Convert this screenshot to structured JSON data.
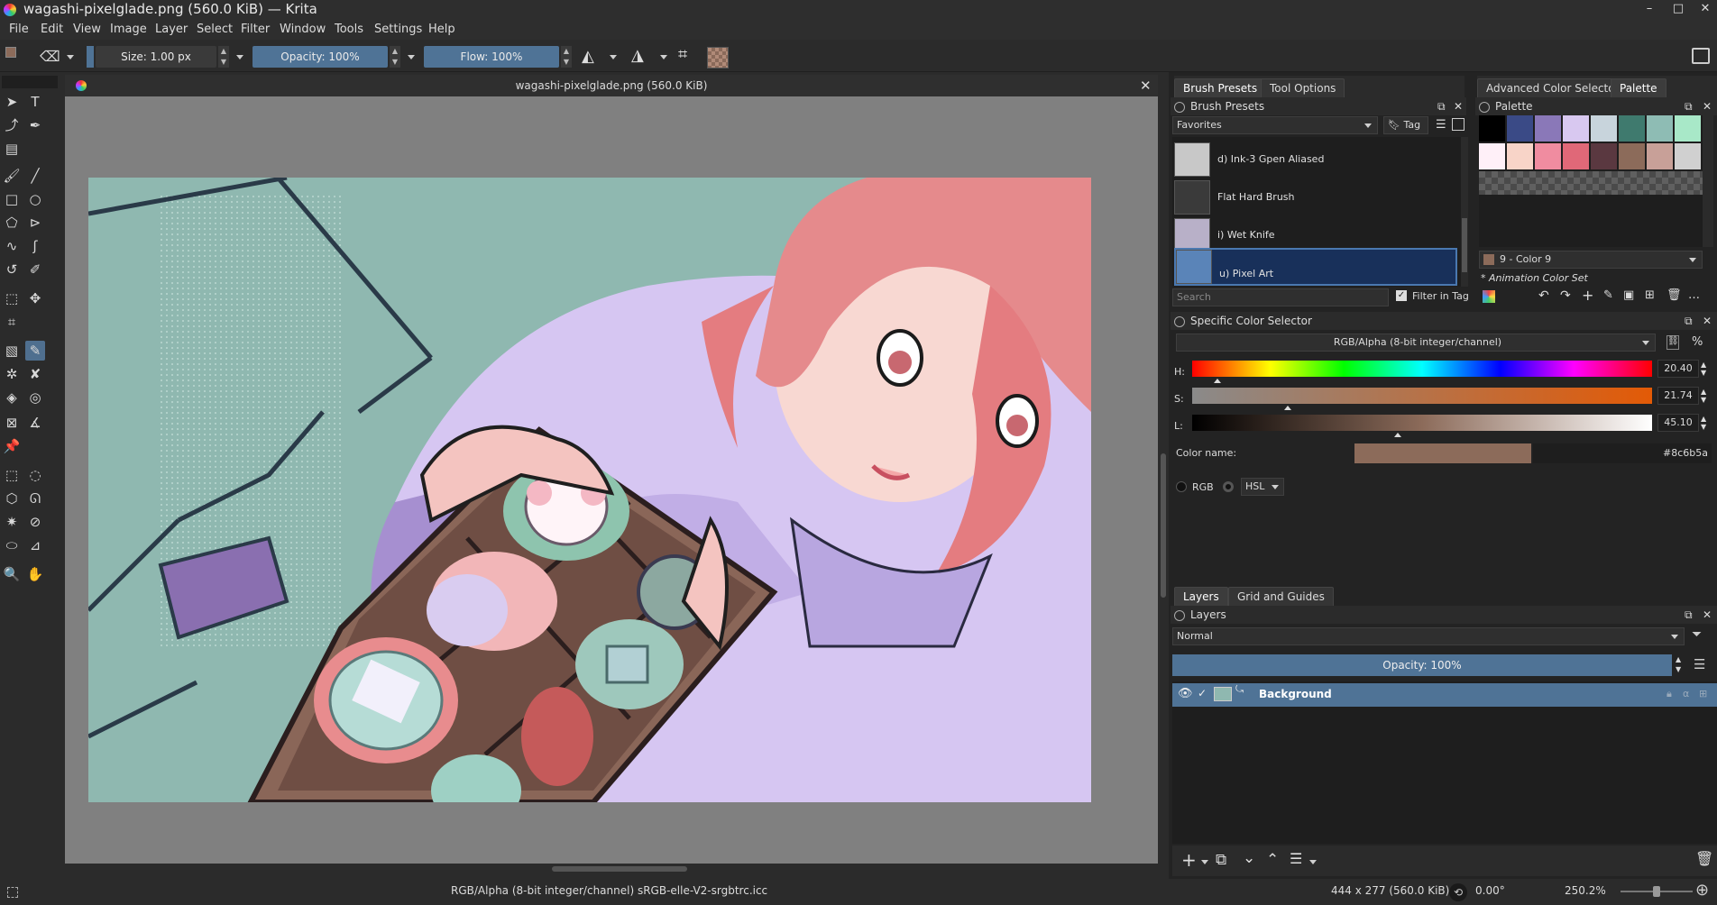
{
  "window": {
    "title": "wagashi-pixelglade.png (560.0 KiB)  — Krita"
  },
  "menu": [
    "File",
    "Edit",
    "View",
    "Image",
    "Layer",
    "Select",
    "Filter",
    "Window",
    "Tools",
    "Settings",
    "Help"
  ],
  "toolbar": {
    "size": "Size: 1.00 px",
    "opacity": "Opacity: 100%",
    "flow": "Flow: 100%"
  },
  "document": {
    "tab_title": "wagashi-pixelglade.png (560.0 KiB)"
  },
  "status": {
    "colorspace": "RGB/Alpha (8-bit integer/channel)  sRGB-elle-V2-srgbtrc.icc",
    "dimensions": "444 x 277 (560.0 KiB)",
    "rotation": "0.00°",
    "zoom": "250.2%"
  },
  "brush_panel": {
    "tabs": [
      "Brush Presets",
      "Tool Options"
    ],
    "title": "Brush Presets",
    "tag_combo": "Favorites",
    "tag_label": "Tag",
    "presets": [
      "d) Ink-3 Gpen Aliased",
      "Flat Hard Brush",
      "i) Wet Knife",
      "u) Pixel Art"
    ],
    "search_placeholder": "Search",
    "filter_label": "Filter in Tag"
  },
  "palette_panel": {
    "tabs": [
      "Advanced Color Selector",
      "Palette"
    ],
    "title": "Palette",
    "row1": [
      "#000000",
      "#3a4a86",
      "#8a78b8",
      "#d8c8f0",
      "#c8d4dc",
      "#3f7a6e",
      "#8ebcb4",
      "#a8e8c8"
    ],
    "row2": [
      "#fff0f8",
      "#f8d4c8",
      "#f08ca0",
      "#e06878",
      "#5a3840",
      "#8c6b5a",
      "#c8a098",
      "#d0d0d0"
    ],
    "current_color": "9 - Color 9",
    "current_hex": "#8c6b5a",
    "set_name": "* Animation Color Set"
  },
  "color_selector": {
    "title": "Specific Color Selector",
    "colorspace": "RGB/Alpha (8-bit integer/channel)",
    "h_label": "H:",
    "h_value": "20.40",
    "s_label": "S:",
    "s_value": "21.74",
    "l_label": "L:",
    "l_value": "45.10",
    "color_name_label": "Color name:",
    "hex": "#8c6b5a",
    "rgb_label": "RGB",
    "model_combo": "HSL"
  },
  "layers_panel": {
    "tabs": [
      "Layers",
      "Grid and Guides"
    ],
    "title": "Layers",
    "blend_mode": "Normal",
    "opacity": "Opacity: 100%",
    "layers": [
      "Background"
    ]
  }
}
